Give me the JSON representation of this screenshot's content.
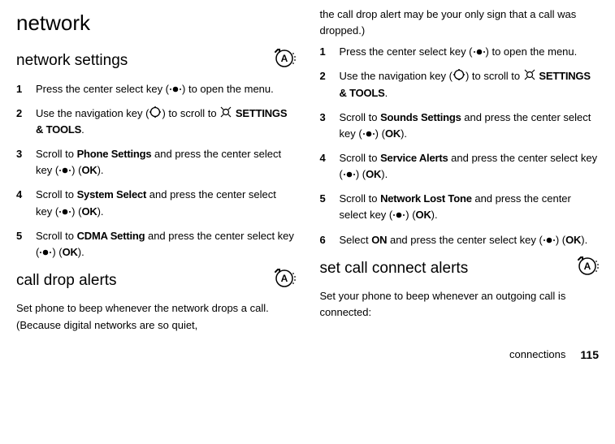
{
  "left": {
    "h1": "network",
    "sec1_title": "network settings",
    "steps1": [
      {
        "n": "1",
        "pre": "Press the center select key (",
        "post": ") to open the menu."
      },
      {
        "n": "2",
        "pre": "Use the navigation key (",
        "mid": ") to scroll to ",
        "bold": "SETTINGS & TOOLS",
        "tail": "."
      },
      {
        "n": "3",
        "a": "Scroll to ",
        "b": "Phone Settings",
        "c": " and press the center select key (",
        "d": ") (",
        "e": "OK",
        "f": ")."
      },
      {
        "n": "4",
        "a": "Scroll to ",
        "b": "System Select",
        "c": " and press the center select key (",
        "d": ") (",
        "e": "OK",
        "f": ")."
      },
      {
        "n": "5",
        "a": "Scroll to ",
        "b": "CDMA Setting",
        "c": " and press the center select key (",
        "d": ") (",
        "e": "OK",
        "f": ")."
      }
    ],
    "sec2_title": "call drop alerts",
    "sec2_body": "Set phone to beep whenever the network drops a call. (Because digital networks are so quiet,"
  },
  "right": {
    "cont_body": "the call drop alert may be your only sign that a call was dropped.)",
    "steps2": [
      {
        "n": "1",
        "pre": "Press the center select key (",
        "post": ") to open the menu."
      },
      {
        "n": "2",
        "pre": "Use the navigation key (",
        "mid": ") to scroll to ",
        "bold": "SETTINGS & TOOLS",
        "tail": "."
      },
      {
        "n": "3",
        "a": "Scroll to ",
        "b": "Sounds Settings",
        "c": " and press the center select key (",
        "d": ") (",
        "e": "OK",
        "f": ")."
      },
      {
        "n": "4",
        "a": "Scroll to ",
        "b": "Service Alerts",
        "c": " and press the center select key (",
        "d": ") (",
        "e": "OK",
        "f": ")."
      },
      {
        "n": "5",
        "a": "Scroll to ",
        "b": "Network Lost Tone",
        "c": " and press the center select key (",
        "d": ") (",
        "e": "OK",
        "f": ")."
      },
      {
        "n": "6",
        "a": "Select ",
        "b": "ON",
        "c": " and press the center select key (",
        "d": ") (",
        "e": "OK",
        "f": ")."
      }
    ],
    "sec3_title": "set call connect alerts",
    "sec3_body": "Set your phone to beep whenever an outgoing call is connected:"
  },
  "footer": {
    "section": "connections",
    "page": "115"
  }
}
